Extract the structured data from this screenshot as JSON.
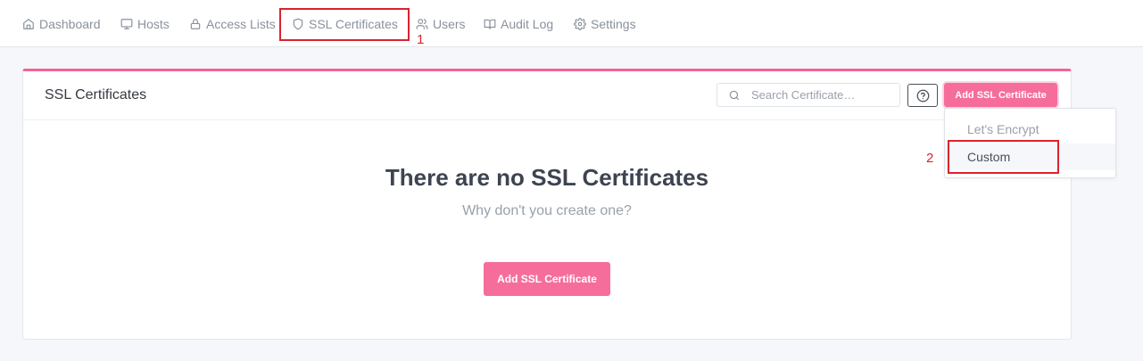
{
  "nav": {
    "items": [
      {
        "label": "Dashboard",
        "icon": "home-icon"
      },
      {
        "label": "Hosts",
        "icon": "monitor-icon"
      },
      {
        "label": "Access Lists",
        "icon": "lock-icon"
      },
      {
        "label": "SSL Certificates",
        "icon": "shield-icon"
      },
      {
        "label": "Users",
        "icon": "users-icon"
      },
      {
        "label": "Audit Log",
        "icon": "book-open-icon"
      },
      {
        "label": "Settings",
        "icon": "gear-icon"
      }
    ]
  },
  "card": {
    "title": "SSL Certificates",
    "search_placeholder": "Search Certificate…",
    "help_icon": "help-circle-icon",
    "add_button_label": "Add SSL Certificate"
  },
  "empty_state": {
    "title": "There are no SSL Certificates",
    "subtitle": "Why don't you create one?",
    "button_label": "Add SSL Certificate"
  },
  "dropdown": {
    "items": [
      {
        "label": "Let's Encrypt"
      },
      {
        "label": "Custom"
      }
    ]
  },
  "annotations": {
    "step1": "1",
    "step2": "2",
    "highlight_color": "#d9232e"
  },
  "colors": {
    "accent": "#f66d9b",
    "card_top_border": "#f06595"
  }
}
